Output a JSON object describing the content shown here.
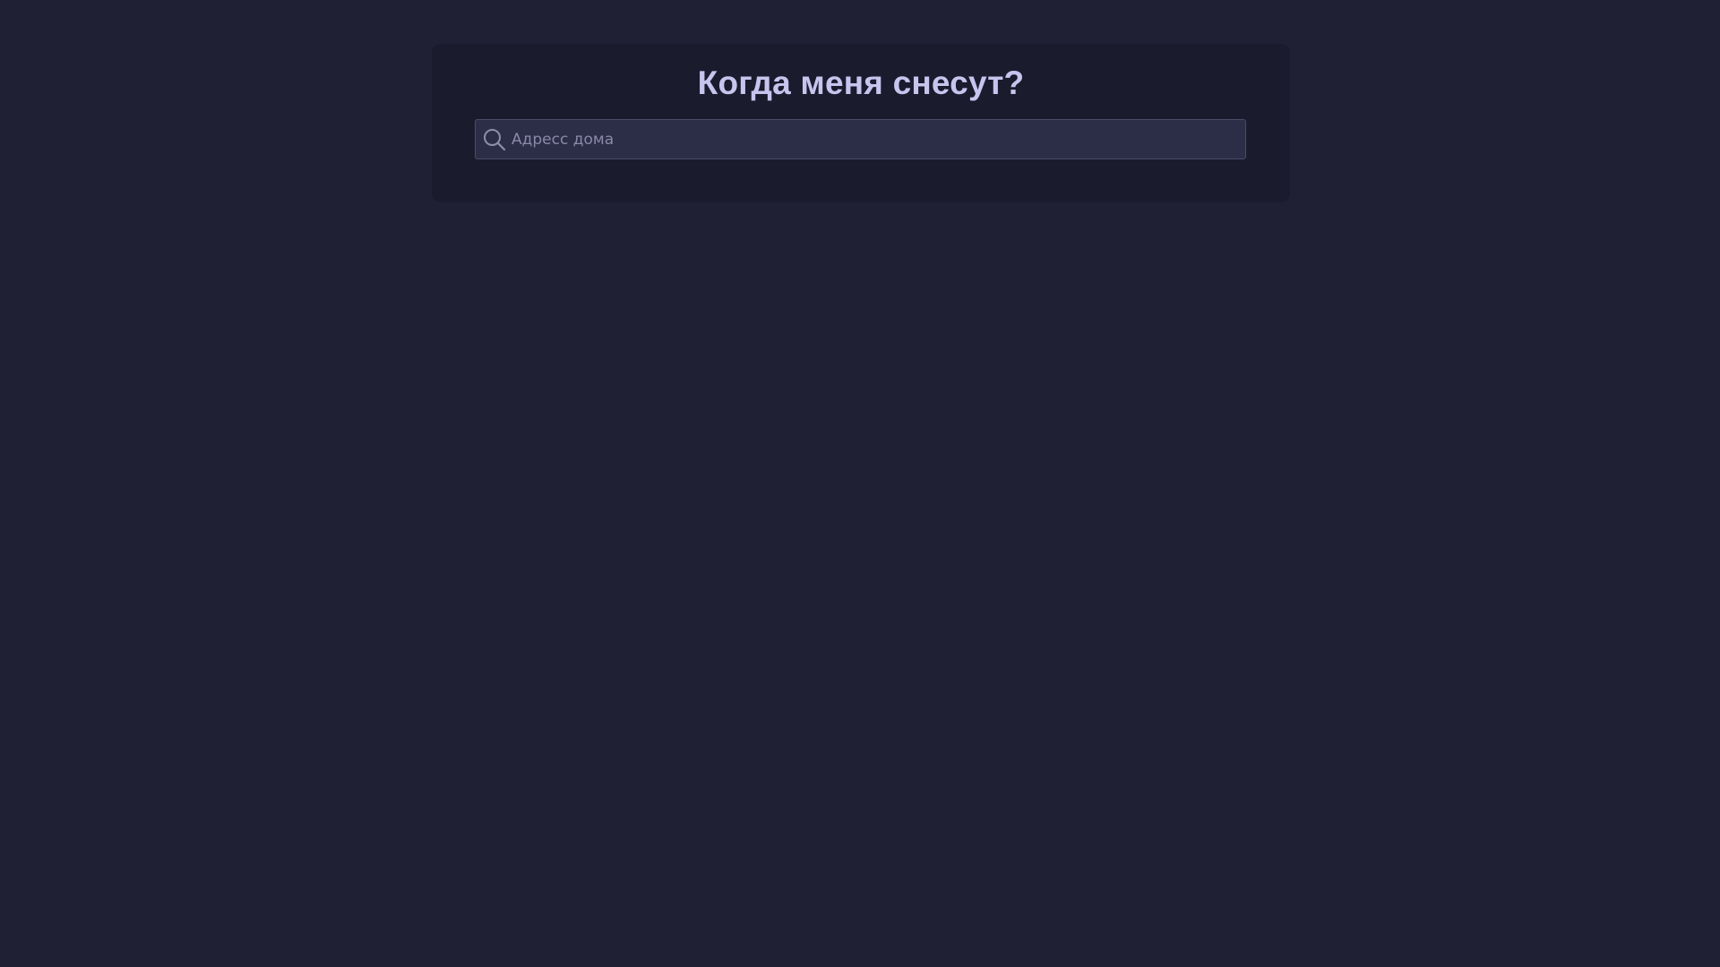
{
  "page": {
    "title": "Когда меня снесут?"
  },
  "search": {
    "placeholder": "Адресс дома",
    "value": "",
    "icon": "search-icon"
  },
  "colors": {
    "background": "#1f2033",
    "panel": "#1a1b2d",
    "title": "#c7c5ee",
    "input_bg": "#2c2d46",
    "input_border": "#4a4b66",
    "placeholder": "#8a8aa6"
  }
}
